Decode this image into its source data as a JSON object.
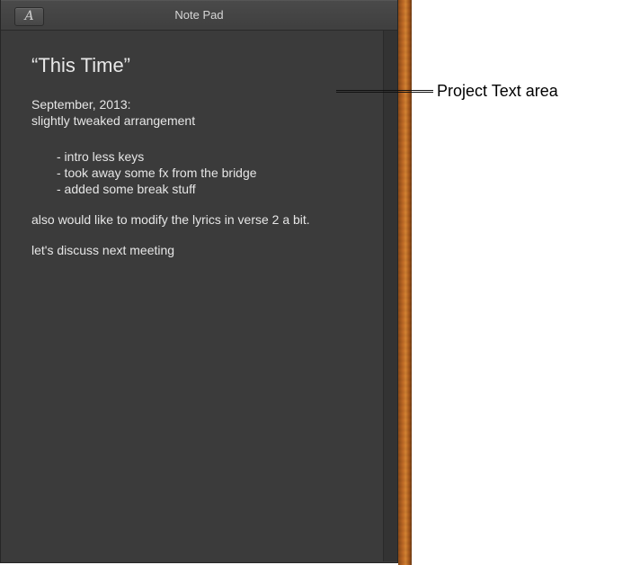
{
  "window": {
    "title": "Note Pad",
    "font_button_label": "A"
  },
  "note": {
    "title": "“This Time”",
    "date": "September, 2013:",
    "line1": "slightly tweaked arrangement",
    "bullets": [
      "- intro less keys",
      "- took away some fx from the bridge",
      "- added some break stuff"
    ],
    "para1": "also would like to modify the lyrics in verse 2 a bit.",
    "para2": "let's discuss next meeting"
  },
  "callout": {
    "label": "Project Text area"
  }
}
